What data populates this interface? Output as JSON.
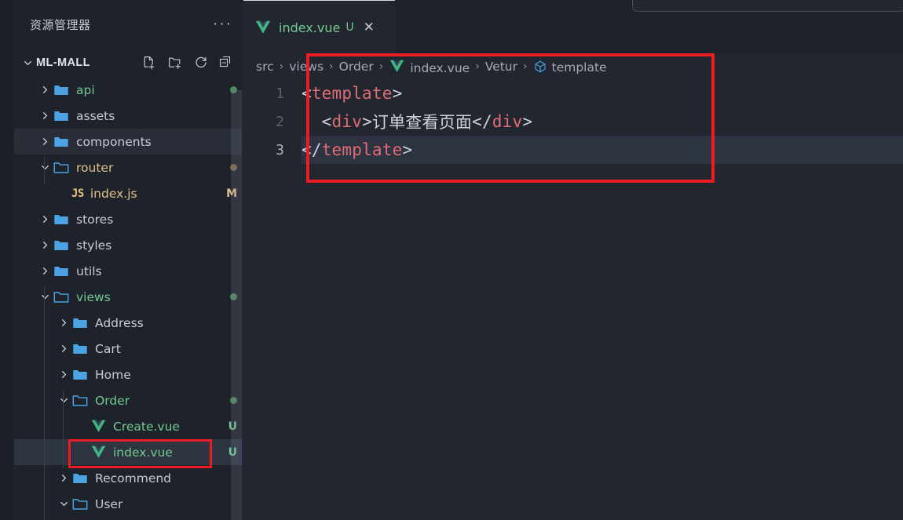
{
  "sidebar": {
    "title": "资源管理器",
    "more_actions_icon": "ellipsis-icon",
    "project": {
      "name": "ML-MALL",
      "expanded": true,
      "actions": [
        {
          "name": "new-file-icon",
          "tooltip": "新建文件"
        },
        {
          "name": "new-folder-icon",
          "tooltip": "新建文件夹"
        },
        {
          "name": "refresh-icon",
          "tooltip": "刷新资源管理器"
        },
        {
          "name": "collapse-all-icon",
          "tooltip": "在资源管理器中折叠文件夹"
        }
      ]
    },
    "tree": [
      {
        "label": "api",
        "kind": "folder",
        "depth": 1,
        "expanded": false,
        "color": "green",
        "dot": "green",
        "badge": "",
        "state": "normal"
      },
      {
        "label": "assets",
        "kind": "folder",
        "depth": 1,
        "expanded": false,
        "color": "plain",
        "dot": "",
        "badge": "",
        "state": "normal"
      },
      {
        "label": "components",
        "kind": "folder",
        "depth": 1,
        "expanded": false,
        "color": "plain",
        "dot": "",
        "badge": "",
        "state": "hover"
      },
      {
        "label": "router",
        "kind": "folder",
        "depth": 1,
        "expanded": true,
        "color": "orange",
        "dot": "orange",
        "badge": "",
        "state": "normal"
      },
      {
        "label": "index.js",
        "kind": "js",
        "depth": 2,
        "expanded": null,
        "color": "orange",
        "dot": "",
        "badge": "M",
        "badge_color": "orange",
        "state": "normal"
      },
      {
        "label": "stores",
        "kind": "folder",
        "depth": 1,
        "expanded": false,
        "color": "plain",
        "dot": "",
        "badge": "",
        "state": "normal"
      },
      {
        "label": "styles",
        "kind": "folder",
        "depth": 1,
        "expanded": false,
        "color": "plain",
        "dot": "",
        "badge": "",
        "state": "normal"
      },
      {
        "label": "utils",
        "kind": "folder",
        "depth": 1,
        "expanded": false,
        "color": "plain",
        "dot": "",
        "badge": "",
        "state": "normal"
      },
      {
        "label": "views",
        "kind": "folder",
        "depth": 1,
        "expanded": true,
        "color": "green",
        "dot": "green",
        "badge": "",
        "state": "normal"
      },
      {
        "label": "Address",
        "kind": "folder",
        "depth": 2,
        "expanded": false,
        "color": "plain",
        "dot": "",
        "badge": "",
        "state": "normal"
      },
      {
        "label": "Cart",
        "kind": "folder",
        "depth": 2,
        "expanded": false,
        "color": "plain",
        "dot": "",
        "badge": "",
        "state": "normal"
      },
      {
        "label": "Home",
        "kind": "folder",
        "depth": 2,
        "expanded": false,
        "color": "plain",
        "dot": "",
        "badge": "",
        "state": "normal"
      },
      {
        "label": "Order",
        "kind": "folder",
        "depth": 2,
        "expanded": true,
        "color": "green",
        "dot": "green",
        "badge": "",
        "state": "normal"
      },
      {
        "label": "Create.vue",
        "kind": "vue",
        "depth": 3,
        "expanded": null,
        "color": "green",
        "dot": "",
        "badge": "U",
        "badge_color": "green",
        "state": "normal"
      },
      {
        "label": "index.vue",
        "kind": "vue",
        "depth": 3,
        "expanded": null,
        "color": "green",
        "dot": "",
        "badge": "U",
        "badge_color": "green",
        "state": "selected"
      },
      {
        "label": "Recommend",
        "kind": "folder",
        "depth": 2,
        "expanded": false,
        "color": "plain",
        "dot": "",
        "badge": "",
        "state": "normal"
      },
      {
        "label": "User",
        "kind": "folder",
        "depth": 2,
        "expanded": true,
        "color": "plain",
        "dot": "",
        "badge": "",
        "state": "normal"
      }
    ]
  },
  "editor": {
    "tab": {
      "filename": "index.vue",
      "git_badge": "U",
      "close_icon": "close-icon",
      "file_icon": "vue-file-icon",
      "active": true
    },
    "breadcrumb": [
      {
        "label": "src",
        "icon": ""
      },
      {
        "label": "views",
        "icon": ""
      },
      {
        "label": "Order",
        "icon": ""
      },
      {
        "label": "index.vue",
        "icon": "vue-file-icon"
      },
      {
        "label": "Vetur",
        "icon": ""
      },
      {
        "label": "template",
        "icon": "symbol-template-icon"
      }
    ],
    "breadcrumb_separator": "›",
    "lines": [
      {
        "number": "1",
        "active": false,
        "indent_guide": false,
        "selected": false,
        "tokens": [
          {
            "t": "<",
            "c": "punct"
          },
          {
            "t": "template",
            "c": "tag"
          },
          {
            "t": ">",
            "c": "punct"
          }
        ]
      },
      {
        "number": "2",
        "active": false,
        "indent_guide": true,
        "selected": false,
        "tokens": [
          {
            "t": "  <",
            "c": "punct"
          },
          {
            "t": "div",
            "c": "tag"
          },
          {
            "t": ">",
            "c": "punct"
          },
          {
            "t": "订单查看页面",
            "c": "text"
          },
          {
            "t": "</",
            "c": "punct"
          },
          {
            "t": "div",
            "c": "tag"
          },
          {
            "t": ">",
            "c": "punct"
          }
        ]
      },
      {
        "number": "3",
        "active": true,
        "indent_guide": false,
        "selected": true,
        "selection_width": 790,
        "tokens": [
          {
            "t": "</",
            "c": "punct"
          },
          {
            "t": "template",
            "c": "tag"
          },
          {
            "t": ">",
            "c": "punct"
          }
        ]
      }
    ]
  },
  "annotations": [
    {
      "name": "editor-highlight-box",
      "color": "#ED1C24"
    },
    {
      "name": "file-highlight-box",
      "color": "#ED1C24"
    }
  ],
  "theme": {
    "background": "#22262E",
    "sidebar_background": "#1E222A",
    "accent_green": "#73C991",
    "accent_orange": "#E2C08D",
    "tag_red": "#E06C75",
    "folder_blue": "#4BA3E3",
    "annotation_red": "#ED1C24"
  }
}
